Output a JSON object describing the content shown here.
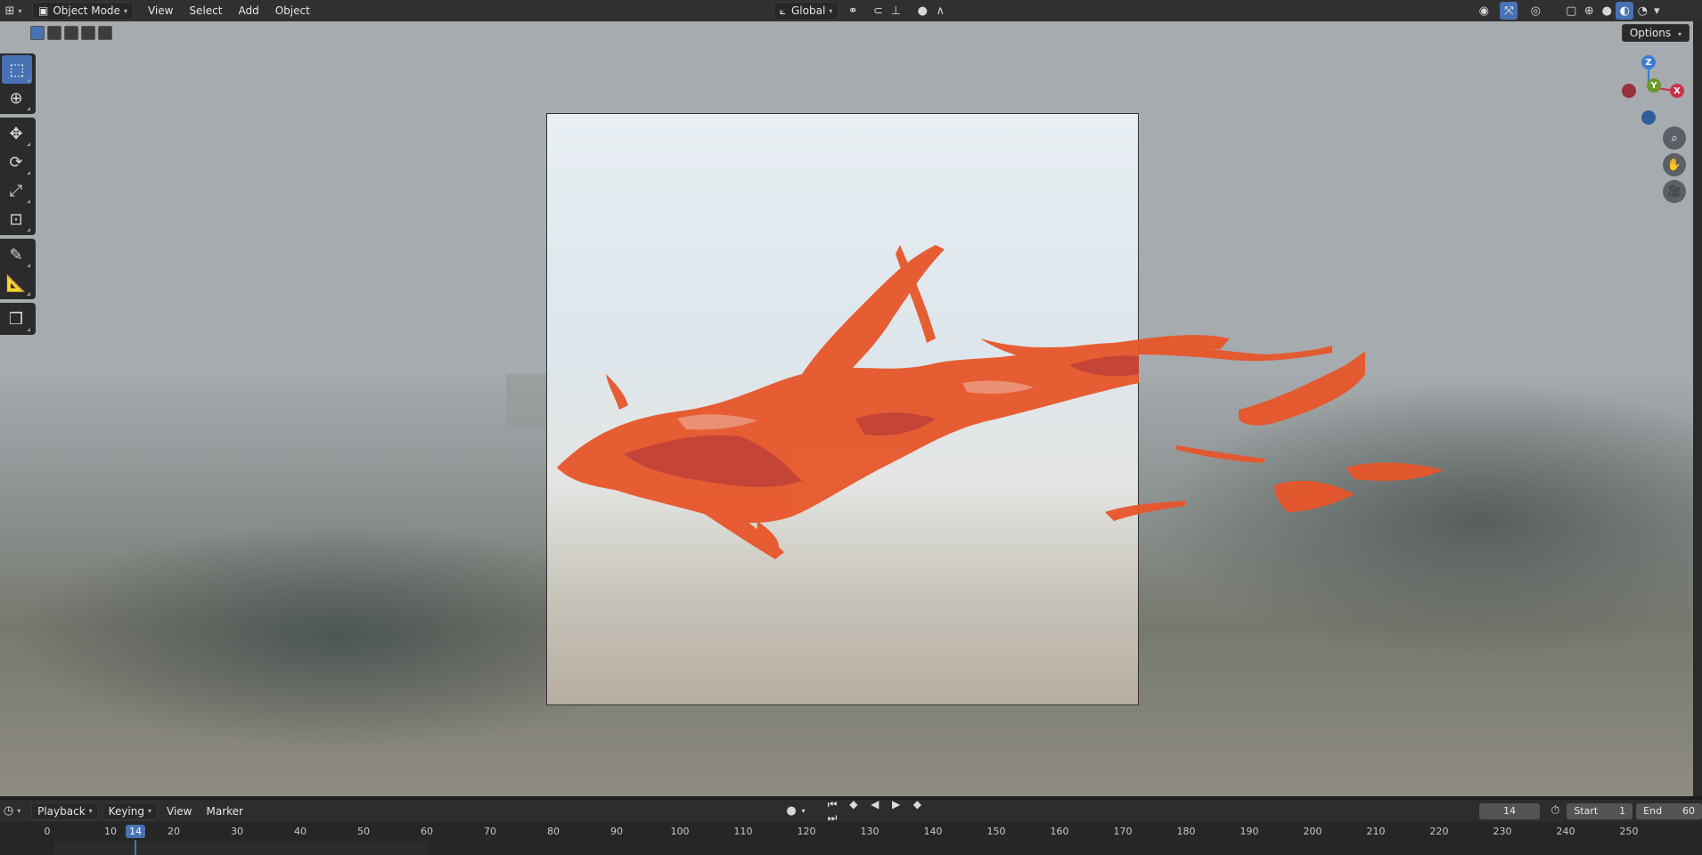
{
  "header": {
    "mode": "Object Mode",
    "menus": [
      "View",
      "Select",
      "Add",
      "Object"
    ],
    "transform_orientation": "Global"
  },
  "viewport": {
    "options_label": "Options",
    "gizmo": {
      "x": "X",
      "y": "Y",
      "z": "Z"
    }
  },
  "toolbar": {
    "tools": [
      "select-box",
      "cursor",
      "move",
      "rotate",
      "scale",
      "transform",
      "annotate",
      "measure",
      "add-cube"
    ]
  },
  "timeline": {
    "menus": [
      "Playback",
      "Keying",
      "View",
      "Marker"
    ],
    "current_frame": "14",
    "start_label": "Start",
    "start_value": "1",
    "end_label": "End",
    "end_value": "60",
    "ticks": [
      "0",
      "10",
      "20",
      "30",
      "40",
      "50",
      "60",
      "70",
      "80",
      "90",
      "100",
      "110",
      "120",
      "130",
      "140",
      "150",
      "160",
      "170",
      "180",
      "190",
      "200",
      "210",
      "220",
      "230",
      "240",
      "250"
    ]
  },
  "colors": {
    "accent": "#4772b3",
    "splash": "#e8562a",
    "axis_x": "#c8344a",
    "axis_y": "#6a9a2c",
    "axis_z": "#3a7bd5"
  }
}
